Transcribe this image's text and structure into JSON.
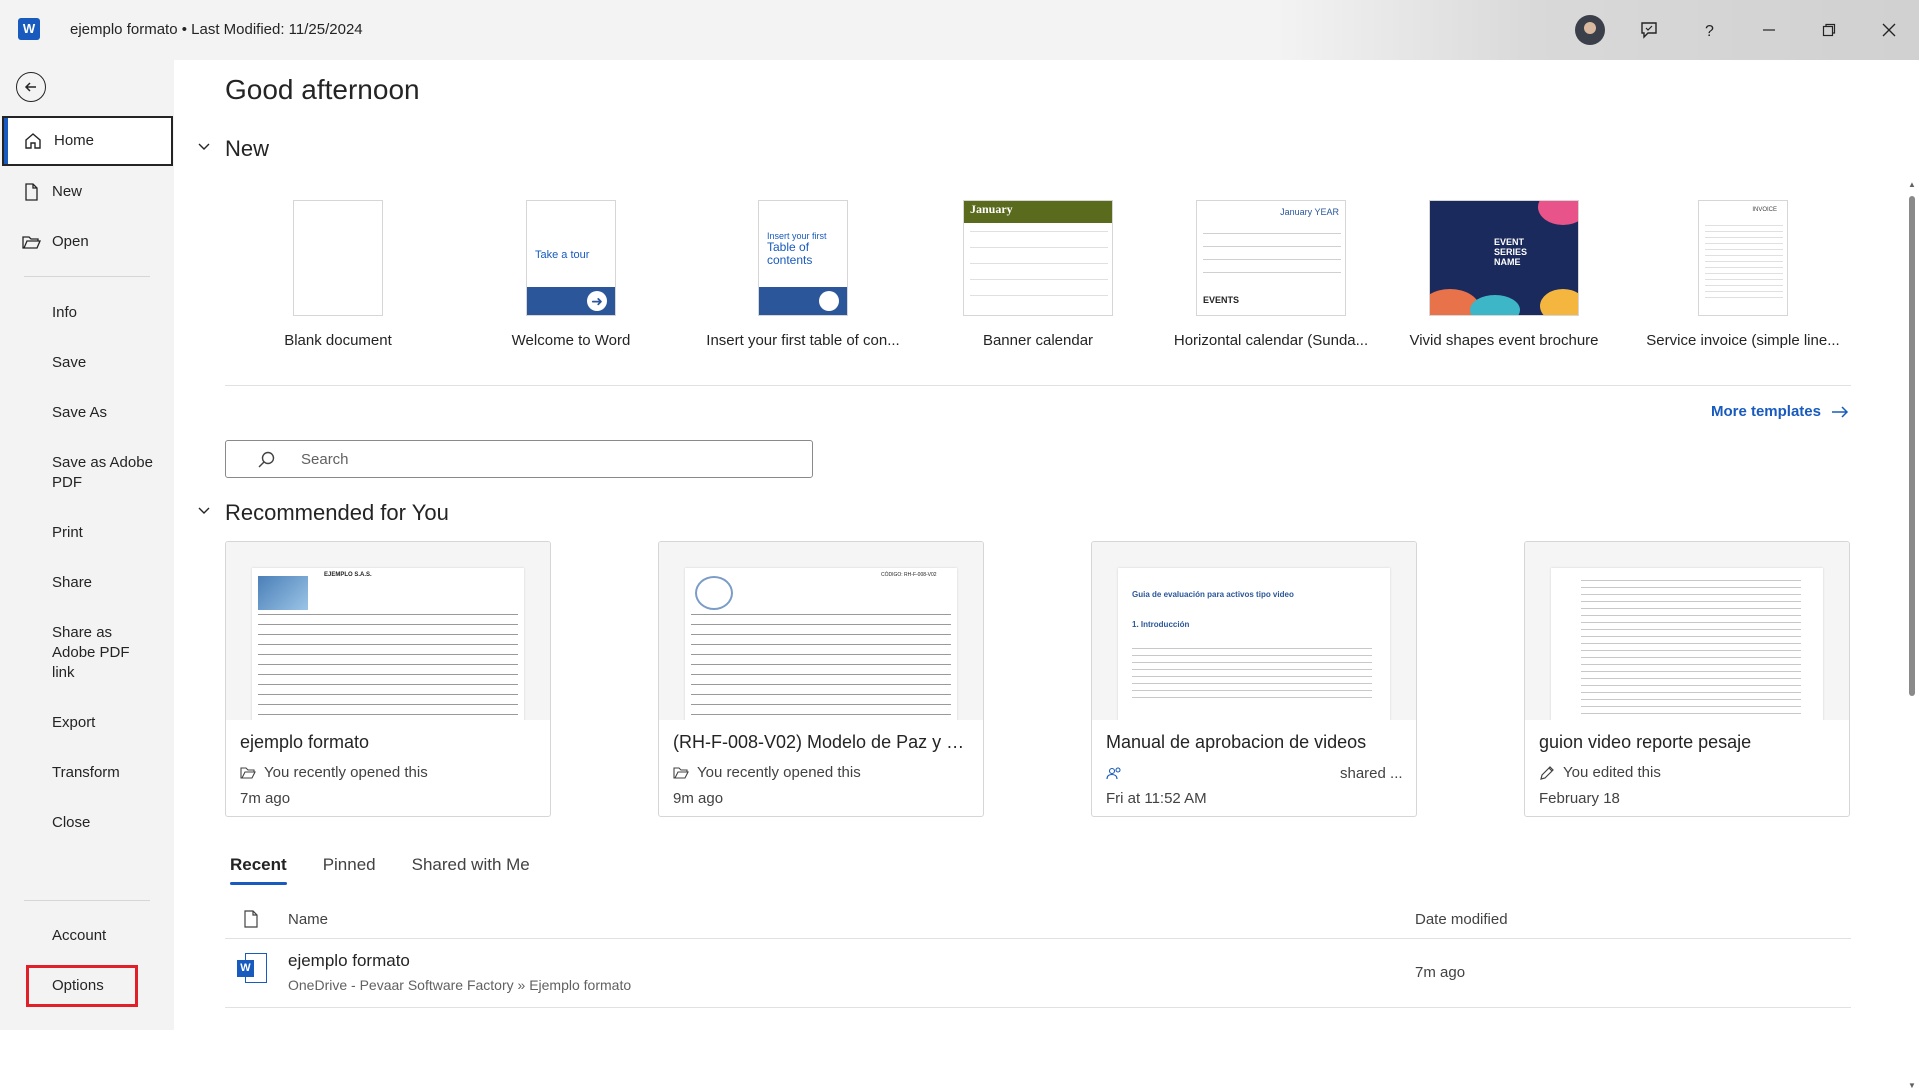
{
  "titlebar": {
    "app_icon": "word-icon",
    "logo_letter": "W",
    "doc_title": "ejemplo formato • Last Modified: 11/25/2024",
    "icons": [
      "avatar",
      "feedback-icon",
      "help-icon",
      "minimize-icon",
      "restore-icon",
      "close-icon"
    ]
  },
  "sidebar": {
    "back_icon": "back-arrow-icon",
    "items": [
      {
        "label": "Home",
        "icon": "home-icon",
        "active": true
      },
      {
        "label": "New",
        "icon": "new-document-icon"
      },
      {
        "label": "Open",
        "icon": "folder-open-icon"
      },
      {
        "label": "Info"
      },
      {
        "label": "Save"
      },
      {
        "label": "Save As"
      },
      {
        "label": "Save as Adobe PDF"
      },
      {
        "label": "Print"
      },
      {
        "label": "Share"
      },
      {
        "label": "Share as Adobe PDF link"
      },
      {
        "label": "Export"
      },
      {
        "label": "Transform"
      },
      {
        "label": "Close"
      },
      {
        "label": "Account"
      },
      {
        "label": "Options",
        "highlighted": true
      }
    ]
  },
  "main": {
    "greeting": "Good afternoon",
    "new_section": {
      "title": "New",
      "templates": [
        {
          "label": "Blank document"
        },
        {
          "label": "Welcome to Word",
          "thumb_text": "Take a tour"
        },
        {
          "label": "Insert your first table of con...",
          "thumb_text_1": "Insert your first",
          "thumb_text_2": "Table of contents"
        },
        {
          "label": "Banner calendar",
          "thumb_text": "January"
        },
        {
          "label": "Horizontal calendar (Sunda...",
          "thumb_text": "January YEAR",
          "thumb_text_2": "EVENTS"
        },
        {
          "label": "Vivid shapes event brochure",
          "thumb_text": "EVENT SERIES NAME"
        },
        {
          "label": "Service invoice (simple line...",
          "thumb_text": "INVOICE"
        }
      ],
      "more_templates": "More templates"
    },
    "search": {
      "placeholder": "Search"
    },
    "recommended": {
      "title": "Recommended for You",
      "cards": [
        {
          "title": "ejemplo formato",
          "status": "You recently opened this",
          "status_icon": "folder-open-icon",
          "time": "7m ago",
          "preview_text": "EJEMPLO S.A.S."
        },
        {
          "title": "(RH-F-008-V02) Modelo de Paz y S...",
          "status": "You recently opened this",
          "status_icon": "folder-open-icon",
          "time": "9m ago",
          "preview_text": "CÓDIGO: RH-F-008-V02"
        },
        {
          "title": "Manual de aprobacion de videos",
          "status": "shared ...",
          "status_icon": "people-icon",
          "time": "Fri at 11:52 AM",
          "preview_heading": "Guia de evaluación para activos tipo video",
          "preview_subheading": "1. Introducción"
        },
        {
          "title": "guion video reporte pesaje",
          "status": "You edited this",
          "status_icon": "pencil-icon",
          "time": "February 18"
        }
      ]
    },
    "tabs": [
      {
        "label": "Recent",
        "active": true
      },
      {
        "label": "Pinned"
      },
      {
        "label": "Shared with Me"
      }
    ],
    "list": {
      "columns": {
        "name": "Name",
        "date": "Date modified"
      },
      "rows": [
        {
          "name": "ejemplo formato",
          "path": "OneDrive - Pevaar Software Factory » Ejemplo formato",
          "date": "7m ago"
        }
      ]
    }
  },
  "colors": {
    "accent": "#185abd",
    "highlight": "#e01f28",
    "sidebar_bg": "#f3f3f3"
  }
}
